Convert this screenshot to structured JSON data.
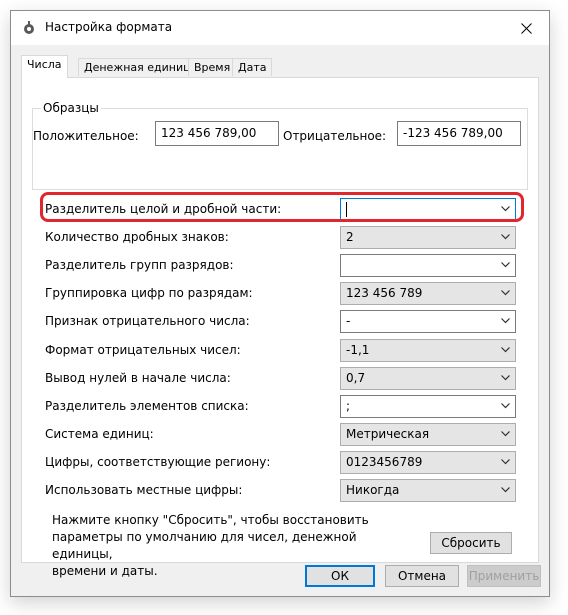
{
  "window": {
    "title": "Настройка формата"
  },
  "tabs": [
    {
      "label": "Числа",
      "active": true
    },
    {
      "label": "Денежная единица",
      "active": false
    },
    {
      "label": "Время",
      "active": false
    },
    {
      "label": "Дата",
      "active": false
    }
  ],
  "samples": {
    "group_title": "Образцы",
    "positive_label": "Положительное:",
    "positive_value": "123 456 789,00",
    "negative_label": "Отрицательное:",
    "negative_value": "-123 456 789,00"
  },
  "settings": [
    {
      "label": "Разделитель целой и дробной части:",
      "value": "",
      "style": "focus"
    },
    {
      "label": "Количество дробных знаков:",
      "value": "2",
      "style": "gray"
    },
    {
      "label": "Разделитель групп разрядов:",
      "value": "",
      "style": "white"
    },
    {
      "label": "Группировка цифр по разрядам:",
      "value": "123 456 789",
      "style": "gray"
    },
    {
      "label": "Признак отрицательного числа:",
      "value": "-",
      "style": "white"
    },
    {
      "label": "Формат отрицательных чисел:",
      "value": "-1,1",
      "style": "gray"
    },
    {
      "label": "Вывод нулей в начале числа:",
      "value": "0,7",
      "style": "gray"
    },
    {
      "label": "Разделитель элементов списка:",
      "value": ";",
      "style": "white"
    },
    {
      "label": "Система единиц:",
      "value": "Метрическая",
      "style": "gray"
    },
    {
      "label": "Цифры, соответствующие региону:",
      "value": "0123456789",
      "style": "gray"
    },
    {
      "label": "Использовать местные цифры:",
      "value": "Никогда",
      "style": "gray"
    }
  ],
  "note": {
    "line1": "Нажмите кнопку \"Сбросить\", чтобы восстановить",
    "line2": "параметры по умолчанию для чисел, денежной единицы,",
    "line3": "времени и даты."
  },
  "buttons": {
    "reset": "Сбросить",
    "ok": "ОК",
    "cancel": "Отмена",
    "apply": "Применить"
  },
  "colors": {
    "accent": "#0078d7",
    "highlight": "#e0272d"
  }
}
